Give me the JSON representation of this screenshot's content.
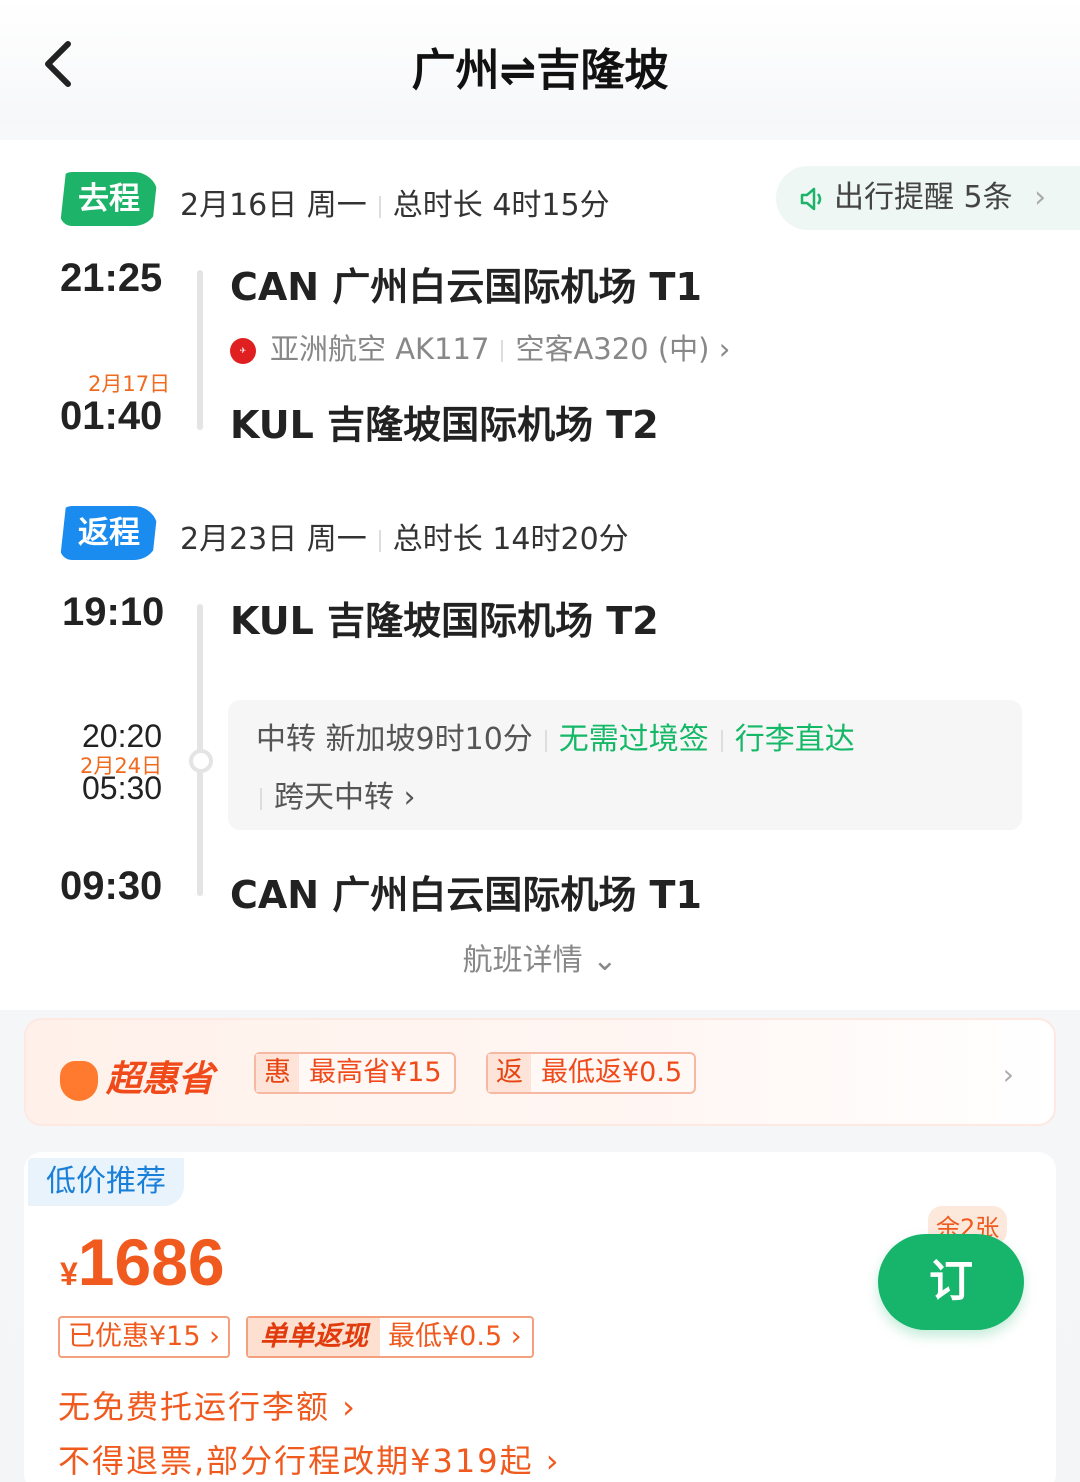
{
  "header": {
    "title": "广州⇌吉隆坡"
  },
  "outbound": {
    "tag": "去程",
    "date": "2月16日 周一",
    "duration": "总时长 4时15分",
    "dep_time": "21:25",
    "dep_airport": "CAN 广州白云国际机场 T1",
    "airline": "亚洲航空 AK117",
    "aircraft": "空客A320 (中) ›",
    "arr_nextday": "2月17日",
    "arr_time": "01:40",
    "arr_airport": "KUL 吉隆坡国际机场 T2"
  },
  "reminder": {
    "label": "出行提醒 5条",
    "chev": "›"
  },
  "inbound": {
    "tag": "返程",
    "date": "2月23日 周一",
    "duration": "总时长 14时20分",
    "dep_time": "19:10",
    "dep_airport": "KUL 吉隆坡国际机场 T2",
    "transfer_arr": "20:20",
    "transfer_date": "2月24日",
    "transfer_dep": "05:30",
    "transfer": "中转 新加坡9时10分",
    "no_visa": "无需过境签",
    "baggage": "行李直达",
    "overnight": "跨天中转 ›",
    "arr_time": "09:30",
    "arr_airport": "CAN 广州白云国际机场 T1"
  },
  "details": "航班详情 ⌄",
  "promo": {
    "brand": "超惠省",
    "chip1_k": "惠",
    "chip1": "最高省¥15",
    "chip2_k": "返",
    "chip2": "最低返¥0.5",
    "arrow": "›"
  },
  "recommend": {
    "tag": "低价推荐",
    "currency": "¥",
    "price": "1686",
    "left": "余2张",
    "book": "订",
    "discount": "已优惠¥15 ›",
    "cashback_k": "单单返现",
    "cashback": "最低¥0.5 ›",
    "rule1": "无免费托运行李额 ›",
    "rule2": "不得退票,部分行程改期¥319起 ›"
  },
  "colors": {
    "green": "#1db46a",
    "blue": "#1a8cf0",
    "orange": "#f05a1e"
  }
}
